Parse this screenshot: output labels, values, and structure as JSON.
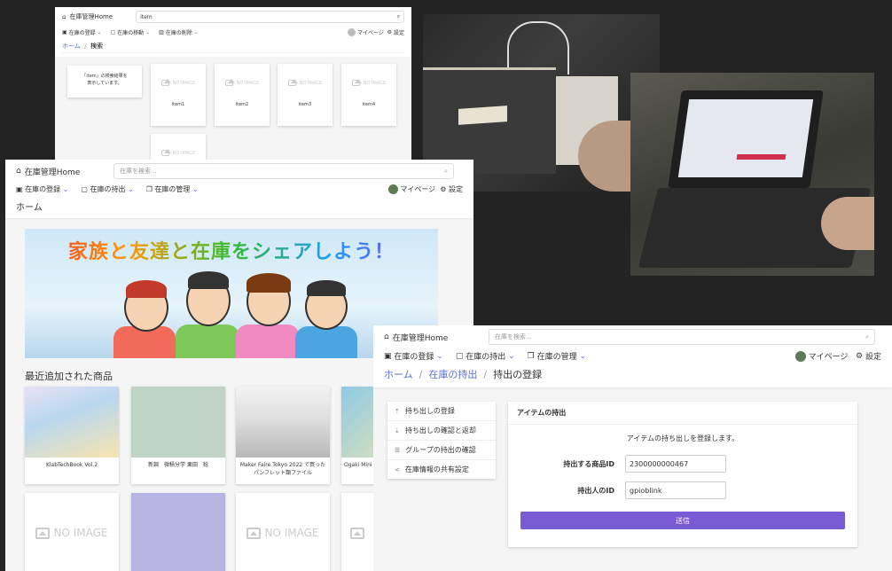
{
  "window_search": {
    "logo": "在庫管理Home",
    "search_value": "item",
    "menu": [
      "在庫の登録",
      "在庫の移動",
      "在庫の削除"
    ],
    "mypage": "マイページ",
    "settings": "設定",
    "breadcrumb": [
      "ホーム",
      "検索"
    ],
    "result_text": [
      "「item」の検索結果を",
      "表示しています。"
    ],
    "no_image": "NO IMAGE",
    "items": [
      "item1",
      "item2",
      "item3",
      "item4"
    ]
  },
  "window_home": {
    "logo": "在庫管理Home",
    "search_placeholder": "在庫を検索...",
    "menu": [
      "在庫の登録",
      "在庫の持出",
      "在庫の管理"
    ],
    "mypage": "マイページ",
    "settings": "設定",
    "breadcrumb": "ホーム",
    "banner_title": "家族と友達と在庫をシェアしよう！",
    "section_title": "最近追加された商品",
    "products": [
      "KlabTechBook Vol.2",
      "新調　微積分学 栗田　稔",
      "Maker Faire Tokyo 2022 で買ったパンフレット類ファイル",
      "Ogaki Mini"
    ],
    "no_image": "NO IMAGE"
  },
  "window_checkout": {
    "logo": "在庫管理Home",
    "search_placeholder": "在庫を検索...",
    "menu": [
      "在庫の登録",
      "在庫の持出",
      "在庫の管理"
    ],
    "mypage": "マイページ",
    "settings": "設定",
    "breadcrumb": [
      "ホーム",
      "在庫の持出",
      "持出の登録"
    ],
    "sidebar": [
      "持ち出しの登録",
      "持ち出しの確認と返却",
      "グループの持出の確認",
      "在庫情報の共有設定"
    ],
    "panel_title": "アイテムの持出",
    "panel_desc": "アイテムの持ち出しを登録します。",
    "item_id_label": "持出する商品ID",
    "item_id_value": "2300000000467",
    "person_id_label": "持出人のID",
    "person_id_value": "gpioblink",
    "submit": "送信"
  },
  "colors": {
    "accent": "#5b6fd8",
    "submit": "#7a5bd6",
    "background": "#232323"
  }
}
